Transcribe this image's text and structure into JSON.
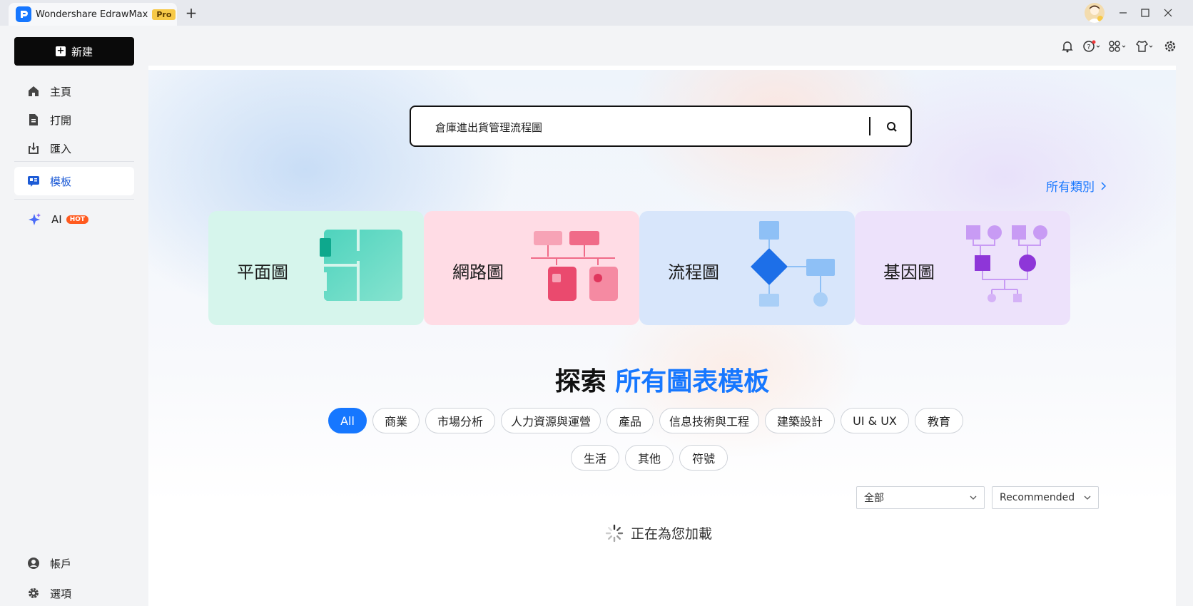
{
  "window": {
    "tab_title": "Wondershare EdrawMax",
    "pro_badge": "Pro",
    "new_tab_symbol": "+"
  },
  "sidebar": {
    "new_button": "新建",
    "items": [
      {
        "label": "主頁",
        "icon": "home-icon"
      },
      {
        "label": "打開",
        "icon": "file-icon"
      },
      {
        "label": "匯入",
        "icon": "import-icon"
      },
      {
        "label": "模板",
        "icon": "template-icon",
        "active": true
      },
      {
        "label": "AI",
        "icon": "sparkle-icon",
        "badge": "HOT"
      }
    ],
    "bottom_items": [
      {
        "label": "帳戶",
        "icon": "account-icon"
      },
      {
        "label": "選項",
        "icon": "gear-icon"
      }
    ]
  },
  "toolbar": {
    "icons": [
      "bell-icon",
      "help-icon",
      "apps-icon",
      "shirt-icon",
      "settings-icon"
    ]
  },
  "search": {
    "value": "倉庫進出貨管理流程圖"
  },
  "categories_link": "所有類別",
  "cards": [
    {
      "label": "平面圖",
      "color": "#d9f6ee"
    },
    {
      "label": "網路圖",
      "color": "#ffdde6"
    },
    {
      "label": "流程圖",
      "color": "#dbe8fb"
    },
    {
      "label": "基因圖",
      "color": "#ece3fb"
    }
  ],
  "explore": {
    "prefix": "探索",
    "highlight": "所有圖表模板"
  },
  "filters": {
    "row1": [
      "All",
      "商業",
      "市場分析",
      "人力資源與運營",
      "產品",
      "信息技術與工程",
      "建築設計",
      "UI & UX",
      "教育"
    ],
    "row2": [
      "生活",
      "其他",
      "符號"
    ],
    "active": "All"
  },
  "dropdowns": {
    "scope": "全部",
    "sort": "Recommended"
  },
  "loading_text": "正在為您加載",
  "colors": {
    "accent": "#1677ff",
    "hot": "#ff5a1f",
    "pro": "#f7c948"
  }
}
